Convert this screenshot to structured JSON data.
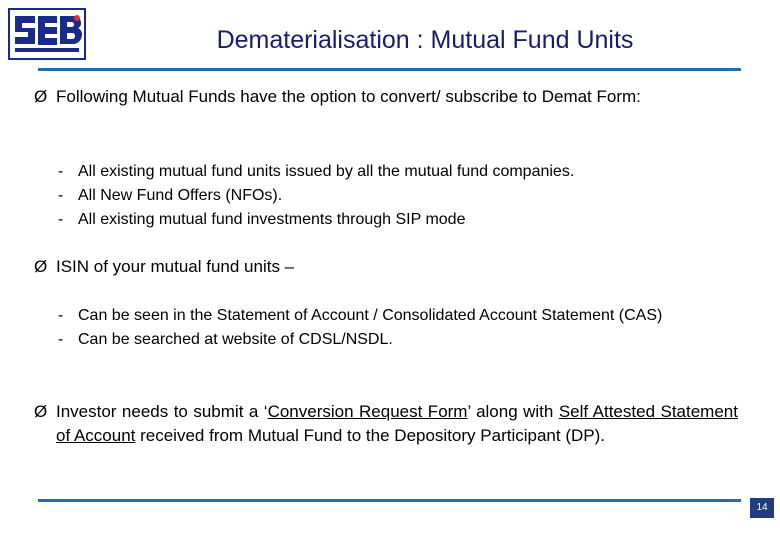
{
  "slide": {
    "title": "Dematerialisation : Mutual Fund Units",
    "page_number": "14",
    "accent_color": "#1f6fa8",
    "title_color": "#1a1a6e",
    "logo": {
      "name": "sebi-logo",
      "text": "SEBI"
    },
    "blocks": [
      {
        "marker": "Ø",
        "text": "Following Mutual Funds have the option to convert/ subscribe to Demat Form:"
      },
      {
        "marker": "Ø",
        "text": "ISIN of your mutual fund units –"
      },
      {
        "marker": "Ø",
        "text_runs": [
          {
            "t": "Investor needs to submit a ‘",
            "u": false
          },
          {
            "t": "Conversion Request Form",
            "u": true
          },
          {
            "t": "’ along with ",
            "u": false
          },
          {
            "t": "Self Attested  Statement  of  Account",
            "u": true
          },
          {
            "t": " received from Mutual Fund to the Depository Participant (DP).",
            "u": false
          }
        ]
      }
    ],
    "sub_items_1": [
      {
        "marker": "-",
        "text": "All existing mutual fund units issued by all the mutual fund companies."
      },
      {
        "marker": "-",
        "text": "All New Fund Offers (NFOs)."
      },
      {
        "marker": "-",
        "text": "All existing mutual fund investments through SIP mode"
      }
    ],
    "sub_items_2": [
      {
        "marker": "-",
        "text": "Can be seen in the Statement of Account / Consolidated Account Statement (CAS)"
      },
      {
        "marker": "-",
        "text": "Can be searched at website of CDSL/NSDL."
      }
    ]
  }
}
